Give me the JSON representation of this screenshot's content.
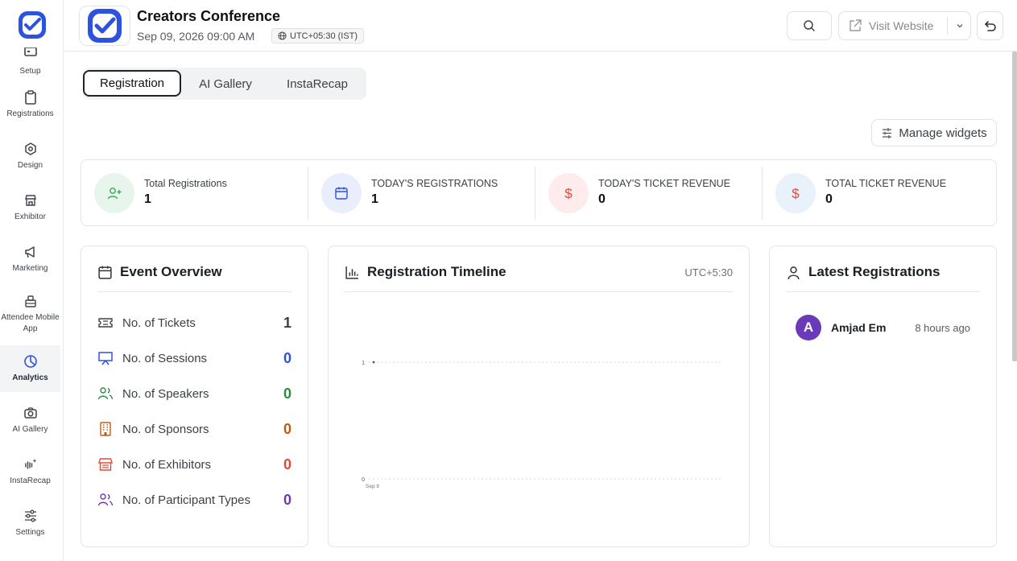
{
  "sidebar": {
    "items": [
      {
        "label": "Setup",
        "icon": "setup-icon"
      },
      {
        "label": "Registrations",
        "icon": "clipboard-icon"
      },
      {
        "label": "Design",
        "icon": "design-icon"
      },
      {
        "label": "Exhibitor",
        "icon": "store-icon"
      },
      {
        "label": "Marketing",
        "icon": "megaphone-icon"
      },
      {
        "label": "Attendee Mobile App",
        "icon": "mobile-app-icon"
      },
      {
        "label": "Analytics",
        "icon": "pie-chart-icon",
        "active": true
      },
      {
        "label": "AI Gallery",
        "icon": "camera-icon"
      },
      {
        "label": "InstaRecap",
        "icon": "sparkle-audio-icon"
      },
      {
        "label": "Settings",
        "icon": "sliders-icon"
      }
    ]
  },
  "header": {
    "event_title": "Creators Conference",
    "event_date": "Sep 09, 2026 09:00 AM",
    "timezone": "UTC+05:30 (IST)",
    "visit_label": "Visit Website"
  },
  "tabs": [
    "Registration",
    "AI Gallery",
    "InstaRecap"
  ],
  "manage_widgets_label": "Manage widgets",
  "stats": [
    {
      "label": "Total Registrations",
      "value": "1",
      "icon": "user-plus-icon",
      "color": "#3aa65a",
      "bg": "#e8f5ec"
    },
    {
      "label": "TODAY'S REGISTRATIONS",
      "value": "1",
      "icon": "calendar-icon",
      "color": "#2d52e0",
      "bg": "#e8eefc"
    },
    {
      "label": "TODAY'S TICKET REVENUE",
      "value": "0",
      "icon": "dollar-icon",
      "color": "#e04b3a",
      "bg": "#fdeceb"
    },
    {
      "label": "TOTAL TICKET REVENUE",
      "value": "0",
      "icon": "dollar-icon",
      "color": "#e04b3a",
      "bg": "#e9f1fb"
    }
  ],
  "overview": {
    "title": "Event Overview",
    "rows": [
      {
        "label": "No. of Tickets",
        "value": "1",
        "color": "#3c4147",
        "icon": "ticket-icon"
      },
      {
        "label": "No. of Sessions",
        "value": "0",
        "color": "#2d52e0",
        "icon": "presentation-icon"
      },
      {
        "label": "No. of Speakers",
        "value": "0",
        "color": "#2e8a3e",
        "icon": "users-icon"
      },
      {
        "label": "No. of Sponsors",
        "value": "0",
        "color": "#c05a12",
        "icon": "building-icon"
      },
      {
        "label": "No. of Exhibitors",
        "value": "0",
        "color": "#e04b3a",
        "icon": "store-icon"
      },
      {
        "label": "No. of Participant Types",
        "value": "0",
        "color": "#6b3ab8",
        "icon": "participants-icon"
      }
    ]
  },
  "timeline": {
    "title": "Registration Timeline",
    "timezone": "UTC+5:30"
  },
  "chart_data": {
    "type": "line",
    "title": "Registration Timeline",
    "x": [
      "Sep 8"
    ],
    "series": [
      {
        "values": [
          1
        ]
      }
    ],
    "ylim": [
      0,
      1
    ],
    "yticks": [
      "1",
      "0"
    ],
    "grid": true
  },
  "latest": {
    "title": "Latest Registrations",
    "items": [
      {
        "initial": "A",
        "name": "Amjad Em",
        "time": "8 hours ago"
      }
    ]
  }
}
